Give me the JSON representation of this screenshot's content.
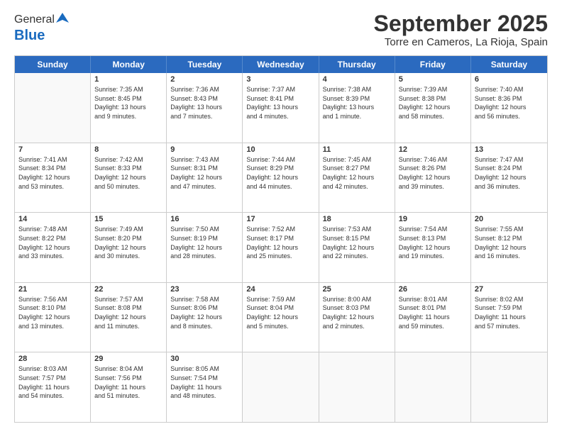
{
  "header": {
    "logo_general": "General",
    "logo_blue": "Blue",
    "month_title": "September 2025",
    "location": "Torre en Cameros, La Rioja, Spain"
  },
  "calendar": {
    "days_of_week": [
      "Sunday",
      "Monday",
      "Tuesday",
      "Wednesday",
      "Thursday",
      "Friday",
      "Saturday"
    ],
    "rows": [
      [
        {
          "day": "",
          "info": ""
        },
        {
          "day": "1",
          "info": "Sunrise: 7:35 AM\nSunset: 8:45 PM\nDaylight: 13 hours\nand 9 minutes."
        },
        {
          "day": "2",
          "info": "Sunrise: 7:36 AM\nSunset: 8:43 PM\nDaylight: 13 hours\nand 7 minutes."
        },
        {
          "day": "3",
          "info": "Sunrise: 7:37 AM\nSunset: 8:41 PM\nDaylight: 13 hours\nand 4 minutes."
        },
        {
          "day": "4",
          "info": "Sunrise: 7:38 AM\nSunset: 8:39 PM\nDaylight: 13 hours\nand 1 minute."
        },
        {
          "day": "5",
          "info": "Sunrise: 7:39 AM\nSunset: 8:38 PM\nDaylight: 12 hours\nand 58 minutes."
        },
        {
          "day": "6",
          "info": "Sunrise: 7:40 AM\nSunset: 8:36 PM\nDaylight: 12 hours\nand 56 minutes."
        }
      ],
      [
        {
          "day": "7",
          "info": "Sunrise: 7:41 AM\nSunset: 8:34 PM\nDaylight: 12 hours\nand 53 minutes."
        },
        {
          "day": "8",
          "info": "Sunrise: 7:42 AM\nSunset: 8:33 PM\nDaylight: 12 hours\nand 50 minutes."
        },
        {
          "day": "9",
          "info": "Sunrise: 7:43 AM\nSunset: 8:31 PM\nDaylight: 12 hours\nand 47 minutes."
        },
        {
          "day": "10",
          "info": "Sunrise: 7:44 AM\nSunset: 8:29 PM\nDaylight: 12 hours\nand 44 minutes."
        },
        {
          "day": "11",
          "info": "Sunrise: 7:45 AM\nSunset: 8:27 PM\nDaylight: 12 hours\nand 42 minutes."
        },
        {
          "day": "12",
          "info": "Sunrise: 7:46 AM\nSunset: 8:26 PM\nDaylight: 12 hours\nand 39 minutes."
        },
        {
          "day": "13",
          "info": "Sunrise: 7:47 AM\nSunset: 8:24 PM\nDaylight: 12 hours\nand 36 minutes."
        }
      ],
      [
        {
          "day": "14",
          "info": "Sunrise: 7:48 AM\nSunset: 8:22 PM\nDaylight: 12 hours\nand 33 minutes."
        },
        {
          "day": "15",
          "info": "Sunrise: 7:49 AM\nSunset: 8:20 PM\nDaylight: 12 hours\nand 30 minutes."
        },
        {
          "day": "16",
          "info": "Sunrise: 7:50 AM\nSunset: 8:19 PM\nDaylight: 12 hours\nand 28 minutes."
        },
        {
          "day": "17",
          "info": "Sunrise: 7:52 AM\nSunset: 8:17 PM\nDaylight: 12 hours\nand 25 minutes."
        },
        {
          "day": "18",
          "info": "Sunrise: 7:53 AM\nSunset: 8:15 PM\nDaylight: 12 hours\nand 22 minutes."
        },
        {
          "day": "19",
          "info": "Sunrise: 7:54 AM\nSunset: 8:13 PM\nDaylight: 12 hours\nand 19 minutes."
        },
        {
          "day": "20",
          "info": "Sunrise: 7:55 AM\nSunset: 8:12 PM\nDaylight: 12 hours\nand 16 minutes."
        }
      ],
      [
        {
          "day": "21",
          "info": "Sunrise: 7:56 AM\nSunset: 8:10 PM\nDaylight: 12 hours\nand 13 minutes."
        },
        {
          "day": "22",
          "info": "Sunrise: 7:57 AM\nSunset: 8:08 PM\nDaylight: 12 hours\nand 11 minutes."
        },
        {
          "day": "23",
          "info": "Sunrise: 7:58 AM\nSunset: 8:06 PM\nDaylight: 12 hours\nand 8 minutes."
        },
        {
          "day": "24",
          "info": "Sunrise: 7:59 AM\nSunset: 8:04 PM\nDaylight: 12 hours\nand 5 minutes."
        },
        {
          "day": "25",
          "info": "Sunrise: 8:00 AM\nSunset: 8:03 PM\nDaylight: 12 hours\nand 2 minutes."
        },
        {
          "day": "26",
          "info": "Sunrise: 8:01 AM\nSunset: 8:01 PM\nDaylight: 11 hours\nand 59 minutes."
        },
        {
          "day": "27",
          "info": "Sunrise: 8:02 AM\nSunset: 7:59 PM\nDaylight: 11 hours\nand 57 minutes."
        }
      ],
      [
        {
          "day": "28",
          "info": "Sunrise: 8:03 AM\nSunset: 7:57 PM\nDaylight: 11 hours\nand 54 minutes."
        },
        {
          "day": "29",
          "info": "Sunrise: 8:04 AM\nSunset: 7:56 PM\nDaylight: 11 hours\nand 51 minutes."
        },
        {
          "day": "30",
          "info": "Sunrise: 8:05 AM\nSunset: 7:54 PM\nDaylight: 11 hours\nand 48 minutes."
        },
        {
          "day": "",
          "info": ""
        },
        {
          "day": "",
          "info": ""
        },
        {
          "day": "",
          "info": ""
        },
        {
          "day": "",
          "info": ""
        }
      ]
    ]
  }
}
